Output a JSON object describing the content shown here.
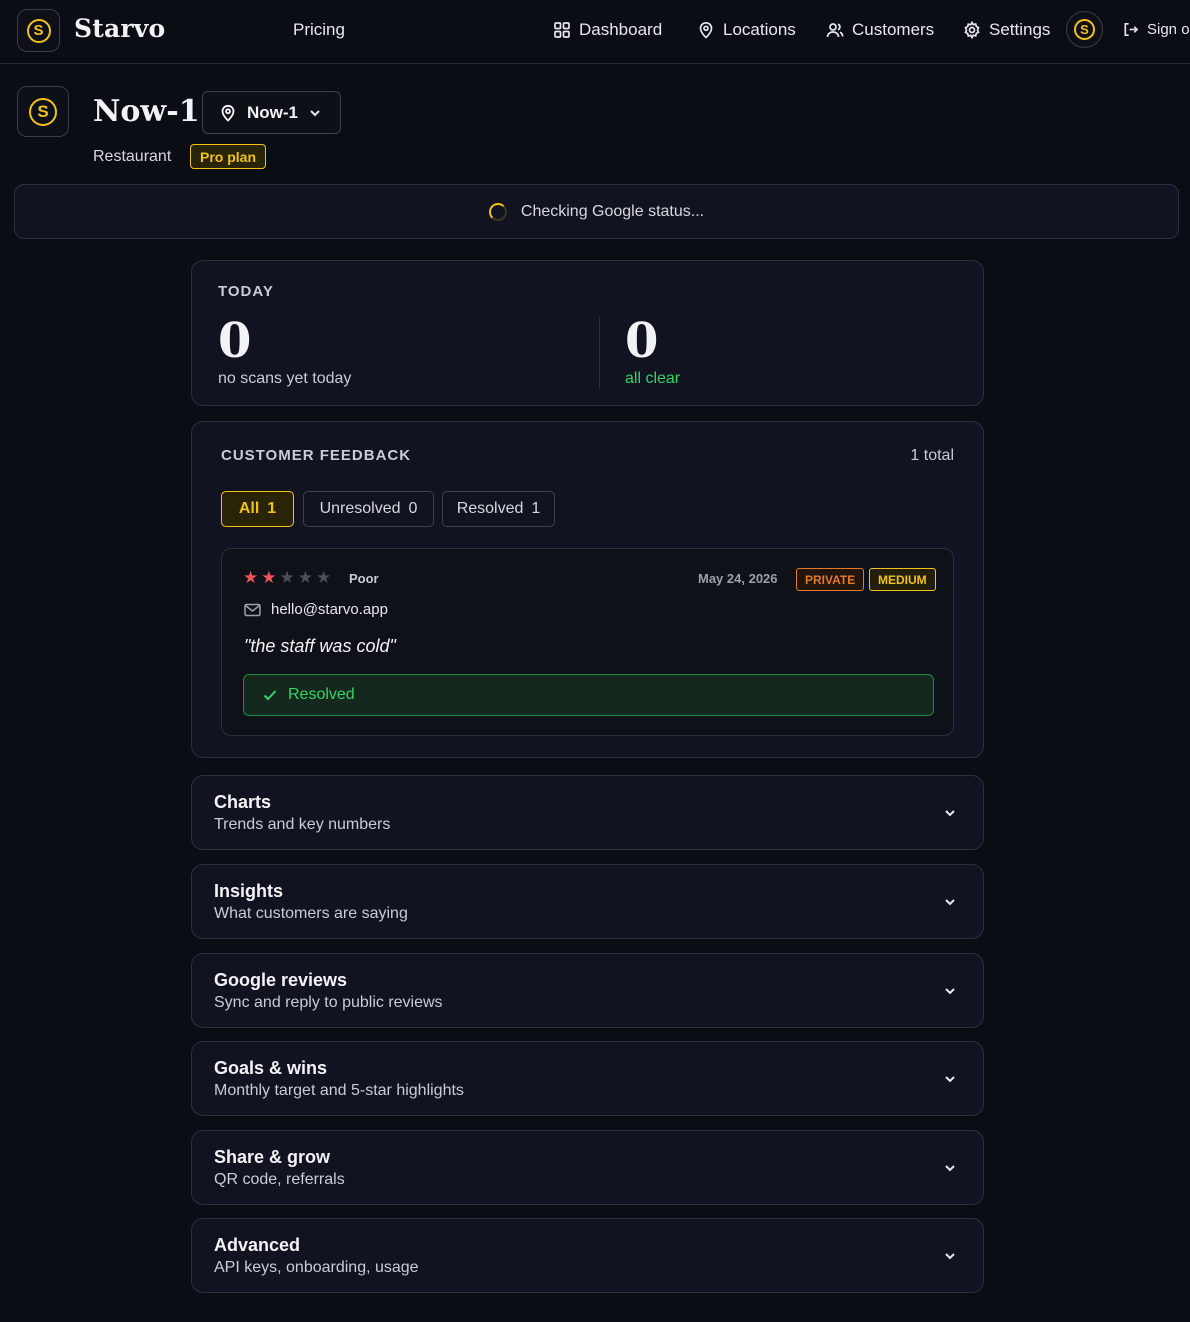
{
  "nav": {
    "brand": "Starvo",
    "logo_letter": "S",
    "pricing": "Pricing",
    "dashboard": "Dashboard",
    "locations": "Locations",
    "customers": "Customers",
    "settings": "Settings",
    "avatar_letter": "S",
    "sign_out": "Sign out",
    "accent_color": "#f2c21b"
  },
  "location": {
    "logo_letter": "S",
    "name": "Now-1",
    "selector_value": "Now-1",
    "type": "Restaurant",
    "plan": "Pro plan"
  },
  "status": {
    "text": "Checking Google status..."
  },
  "today": {
    "label": "TODAY",
    "scans_value": "0",
    "scans_caption": "no scans yet today",
    "issues_value": "0",
    "issues_caption": "all clear"
  },
  "feedback": {
    "label": "CUSTOMER FEEDBACK",
    "total": "1 total",
    "filters": [
      {
        "label": "All",
        "count": "1",
        "active": true
      },
      {
        "label": "Unresolved",
        "count": "0",
        "active": false
      },
      {
        "label": "Resolved",
        "count": "1",
        "active": false
      }
    ],
    "review": {
      "rating": 2,
      "max_rating": 5,
      "rating_word": "Poor",
      "date": "May 24, 2026",
      "tags": [
        "PRIVATE",
        "MEDIUM"
      ],
      "email": "hello@starvo.app",
      "quote": "\"the staff was cold\"",
      "status": "Resolved"
    }
  },
  "sections": [
    {
      "title": "Charts",
      "subtitle": "Trends and key numbers"
    },
    {
      "title": "Insights",
      "subtitle": "What customers are saying"
    },
    {
      "title": "Google reviews",
      "subtitle": "Sync and reply to public reviews"
    },
    {
      "title": "Goals & wins",
      "subtitle": "Monthly target and 5-star highlights"
    },
    {
      "title": "Share & grow",
      "subtitle": "QR code, referrals"
    },
    {
      "title": "Advanced",
      "subtitle": "API keys, onboarding, usage"
    }
  ]
}
